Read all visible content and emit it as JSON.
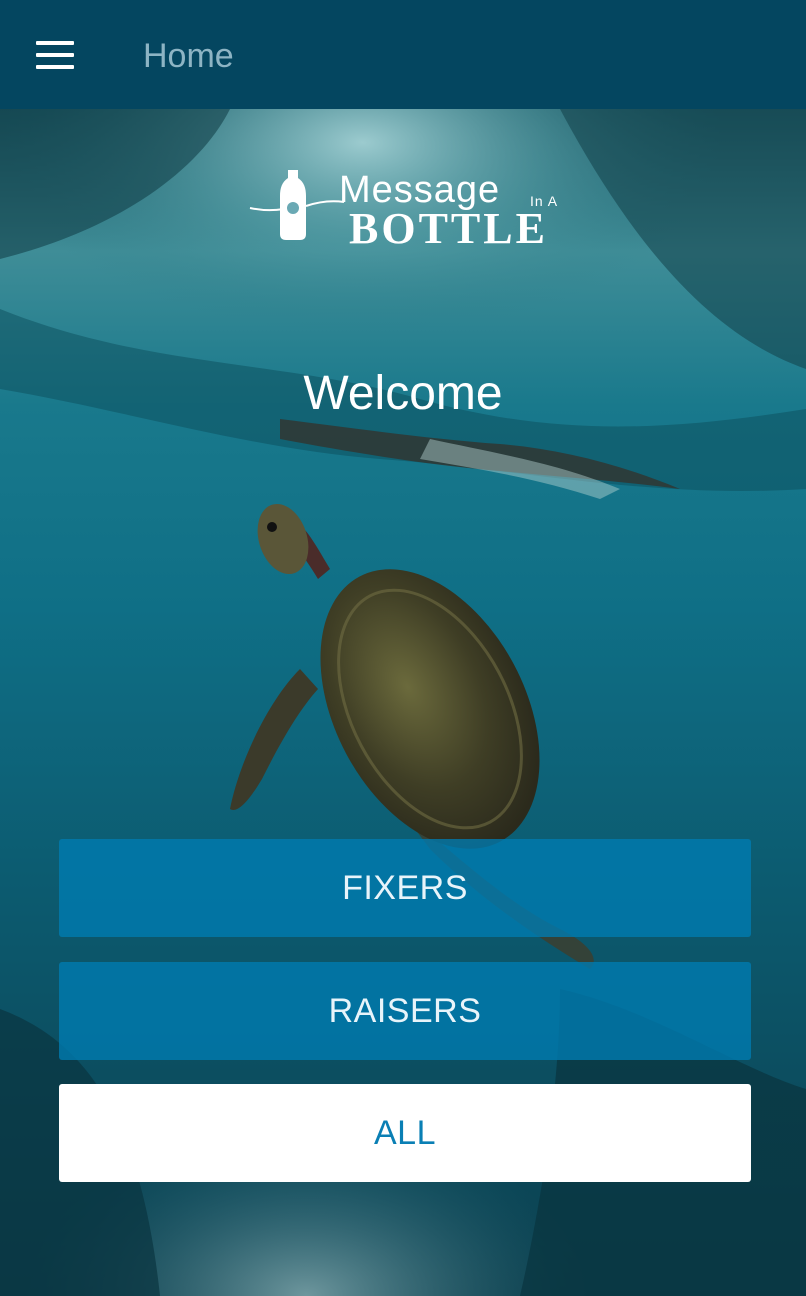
{
  "app_bar": {
    "title": "Home",
    "menu_icon": "hamburger-menu-icon",
    "background_color": "#044660"
  },
  "logo": {
    "word_message": "Message",
    "word_in_a": "In A",
    "word_bottle": "BOTTLE",
    "icon": "bottle-logo-icon"
  },
  "hero": {
    "welcome": "Welcome",
    "background": "underwater sea turtle photo"
  },
  "buttons": {
    "fixers": "FIXERS",
    "raisers": "RAISERS",
    "all": "ALL"
  },
  "colors": {
    "primary": "#007cb2",
    "button_all_text": "#0a7fb4",
    "title_text": "#8db4c4"
  }
}
